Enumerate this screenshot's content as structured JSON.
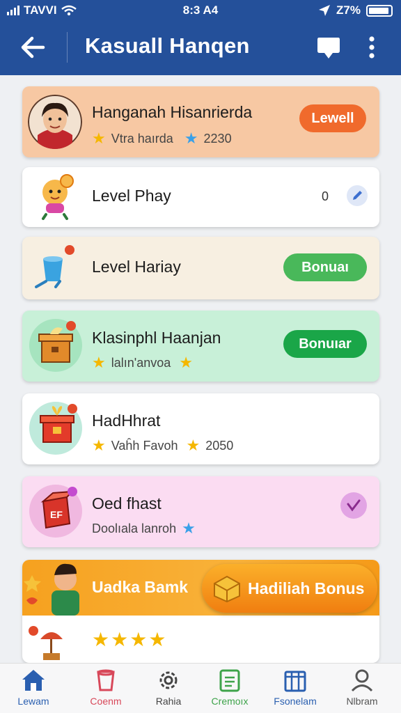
{
  "status": {
    "carrier": "TAVVI",
    "time": "8:3 A4",
    "battery": "Z7%"
  },
  "header": {
    "title": "Kasuall Hanqen"
  },
  "cards": [
    {
      "title": "Hanganah Hisanrierda",
      "subtitle": "Vtra haırda",
      "value": "2230",
      "button": "Lewell"
    },
    {
      "title": "Level Phay",
      "count": "0"
    },
    {
      "title": "Level Hariay",
      "button": "Bonuaı"
    },
    {
      "title": "Klasinphl Haanjan",
      "subtitle": "lalın'anvoa",
      "button": "Bonuıar"
    },
    {
      "title": "HadHhrat",
      "subtitle": "Vaĥh Favoh",
      "value": "2050"
    },
    {
      "title": "Oed fhast",
      "subtitle": "Doolıala lanroh"
    }
  ],
  "banner": {
    "label": "Uadka Bamk",
    "button": "Hadiliah Bonus"
  },
  "nav": [
    {
      "label": "Lewam",
      "color": "#2a5fb0"
    },
    {
      "label": "Coenm",
      "color": "#d8485a"
    },
    {
      "label": "Rahia",
      "color": "#444444"
    },
    {
      "label": "Cremoıx",
      "color": "#3ea34a"
    },
    {
      "label": "Fsonelam",
      "color": "#2a5fb0"
    },
    {
      "label": "Nlbram",
      "color": "#555555"
    }
  ]
}
